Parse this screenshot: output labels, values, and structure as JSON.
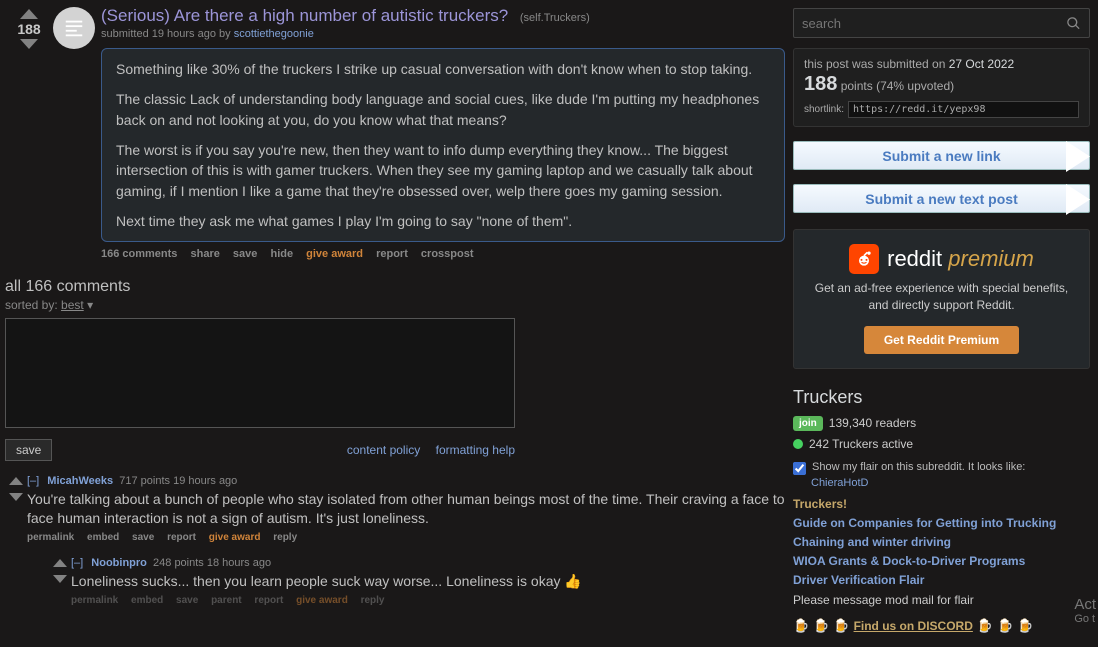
{
  "search": {
    "placeholder": "search"
  },
  "post": {
    "title": "(Serious) Are there a high number of autistic truckers?",
    "domain": "(self.Truckers)",
    "submitted_prefix": "submitted ",
    "age": "19 hours ago",
    "by": " by ",
    "author": "scottiethegoonie",
    "score": "188",
    "paragraphs": [
      "Something like 30% of the truckers I strike up casual conversation with don't know when to stop taking.",
      "The classic Lack of understanding body language and social cues, like dude I'm putting my headphones back on and not looking at you, do you know what that means?",
      "The worst is if you say you're new, then they want to info dump everything they know... The biggest intersection of this is with gamer truckers. When they see my gaming laptop and we casually talk about gaming, if I mention I like a game that they're obsessed over, welp there goes my gaming session.",
      "Next time they ask me what games I play I'm going to say \"none of them\"."
    ],
    "flat": {
      "comments": "166 comments",
      "share": "share",
      "save": "save",
      "hide": "hide",
      "award": "give award",
      "report": "report",
      "crosspost": "crosspost"
    }
  },
  "panestack": {
    "title": "all 166 comments",
    "sorted_prefix": "sorted by: ",
    "sort_value": "best"
  },
  "form": {
    "save": "save",
    "content_policy": "content policy",
    "formatting_help": "formatting help"
  },
  "comments": [
    {
      "collapse": "[–]",
      "author": "MicahWeeks",
      "points": "717 points",
      "age": "19 hours ago",
      "body": "You're talking about a bunch of people who stay isolated from other human beings most of the time. Their craving a face to face human interaction is not a sign of autism. It's just loneliness.",
      "child": {
        "collapse": "[–]",
        "author": "Noobinpro",
        "points": "248 points",
        "age": "18 hours ago",
        "body": "Loneliness sucks... then you learn people suck way worse... Loneliness is okay 👍"
      }
    }
  ],
  "cflat": {
    "permalink": "permalink",
    "embed": "embed",
    "save": "save",
    "report": "report",
    "award": "give award",
    "reply": "reply",
    "parent": "parent"
  },
  "infobox": {
    "prefix": "this post was submitted on ",
    "date": "27 Oct 2022",
    "score": "188",
    "points_label": " points ",
    "upvoted": "(74% upvoted)",
    "shortlink_label": "shortlink:",
    "shortlink": "https://redd.it/yepx98"
  },
  "submit": {
    "link": "Submit a new link",
    "text": "Submit a new text post"
  },
  "premium": {
    "word1": "reddit",
    "word2": "premium",
    "desc": "Get an ad-free experience with special benefits, and directly support Reddit.",
    "button": "Get Reddit Premium"
  },
  "subreddit": {
    "name": "Truckers",
    "join": "join",
    "readers": "139,340 readers",
    "active": "242 Truckers active",
    "flair_text": "Show my flair on this subreddit. It looks like:",
    "flair_name": "ChieraHotD"
  },
  "sidelinks": {
    "header": "Truckers!",
    "links": [
      "Guide on Companies for Getting into Trucking",
      "Chaining and winter driving",
      "WIOA Grants & Dock-to-Driver Programs",
      "Driver Verification Flair"
    ],
    "modmail": "Please message mod mail for flair",
    "discord": "Find us on DISCORD"
  },
  "watermark": {
    "line1": "Act",
    "line2": "Go t"
  }
}
